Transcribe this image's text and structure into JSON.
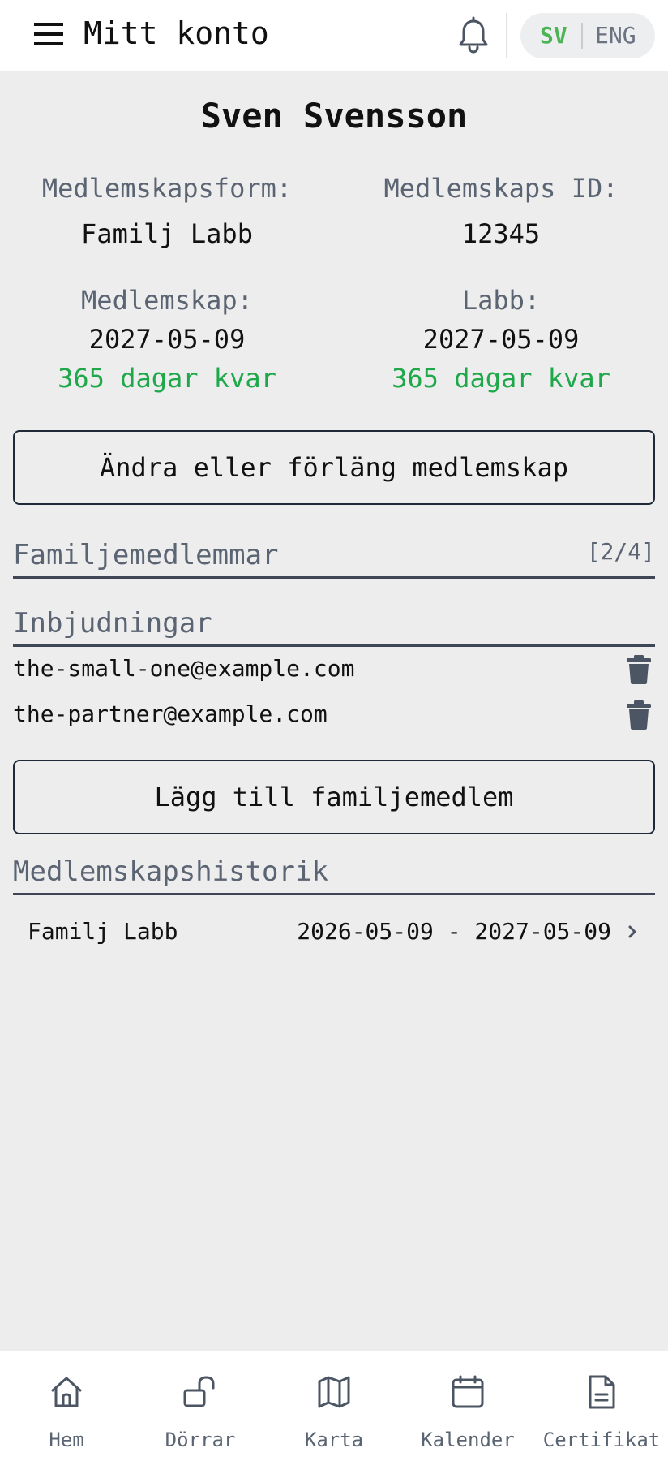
{
  "header": {
    "title": "Mitt konto",
    "menu_icon": "hamburger-menu-icon",
    "notification_icon": "bell-icon",
    "languages": {
      "active": "SV",
      "other": "ENG",
      "active_color": "#4bb556"
    }
  },
  "profile": {
    "name": "Sven Svensson",
    "membership_type_label": "Medlemskapsform:",
    "membership_type_value": "Familj Labb",
    "membership_id_label": "Medlemskaps ID:",
    "membership_id_value": "12345",
    "membership_label": "Medlemskap:",
    "membership_date": "2027-05-09",
    "membership_days_left": "365 dagar kvar",
    "lab_label": "Labb:",
    "lab_date": "2027-05-09",
    "lab_days_left": "365 dagar kvar",
    "days_color": "#1ea84a"
  },
  "actions": {
    "change_membership": "Ändra eller förläng medlemskap",
    "add_family_member": "Lägg till familjemedlem"
  },
  "family": {
    "title": "Familjemedlemmar",
    "count": "[2/4]"
  },
  "invitations": {
    "title": "Inbjudningar",
    "items": [
      {
        "email": "the-small-one@example.com",
        "icon": "trash-icon"
      },
      {
        "email": "the-partner@example.com",
        "icon": "trash-icon"
      }
    ]
  },
  "history": {
    "title": "Medlemskapshistorik",
    "items": [
      {
        "type": "Familj Labb",
        "period": "2026-05-09 - 2027-05-09",
        "icon": "chevron-right-icon"
      }
    ]
  },
  "bottom_nav": {
    "items": [
      {
        "label": "Hem",
        "icon": "home-icon"
      },
      {
        "label": "Dörrar",
        "icon": "unlock-icon"
      },
      {
        "label": "Karta",
        "icon": "map-icon"
      },
      {
        "label": "Kalender",
        "icon": "calendar-icon"
      },
      {
        "label": "Certifikat",
        "icon": "document-icon"
      }
    ]
  }
}
